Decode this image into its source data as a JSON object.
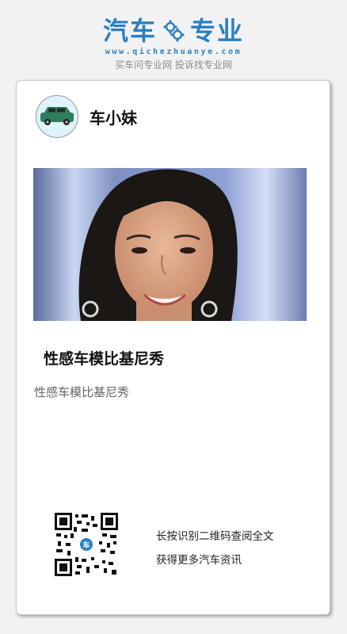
{
  "brand": {
    "word_left": "汽车",
    "word_right": "专业",
    "logo_icon": "gear-icon",
    "url": "www.qichezhuanye.com",
    "tagline": "买车问专业网 投诉找专业网",
    "color": "#2a7fc3"
  },
  "card": {
    "author": {
      "name": "车小妹",
      "avatar_icon": "car-icon"
    },
    "article": {
      "title": "性感车模比基尼秀",
      "summary": "性感车模比基尼秀"
    },
    "qr": {
      "icon": "qr-code-icon",
      "line1": "长按识别二维码查阅全文",
      "line2": "获得更多汽车资讯"
    }
  }
}
